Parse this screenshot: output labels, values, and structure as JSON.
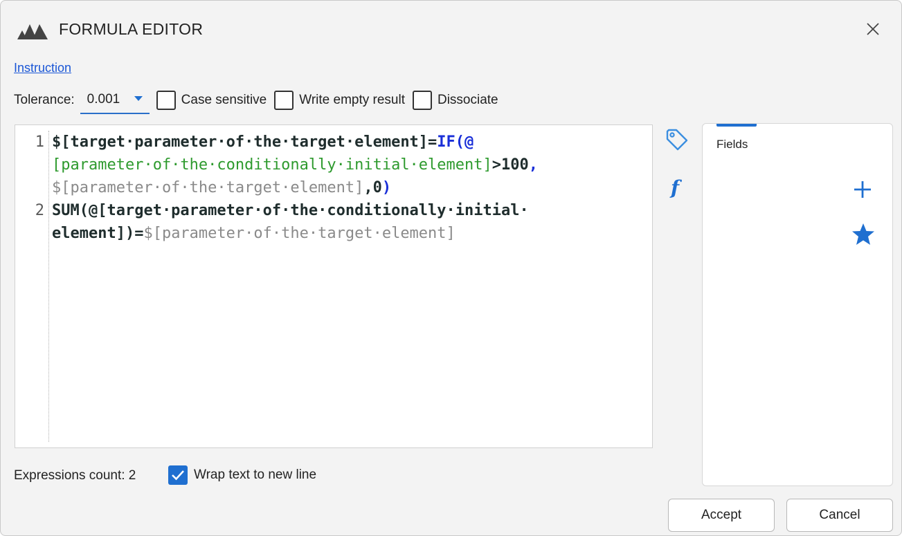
{
  "window": {
    "title": "FORMULA EDITOR",
    "logo_icon": "app-logo-icon",
    "close_icon": "close-icon"
  },
  "instruction_link": "Instruction",
  "options": {
    "tolerance_label": "Tolerance:",
    "tolerance_value": "0.001",
    "case_sensitive_label": "Case sensitive",
    "case_sensitive_checked": false,
    "write_empty_label": "Write empty result",
    "write_empty_checked": false,
    "dissociate_label": "Dissociate",
    "dissociate_checked": false
  },
  "editor": {
    "lines": [
      {
        "number": "1",
        "rows": [
          [
            {
              "text": "$[target·parameter·of·the·target·element]=",
              "style": "t-dark"
            },
            {
              "text": "IF(@",
              "style": "t-kw"
            }
          ],
          [
            {
              "text": "[parameter·of·the·conditionally·initial·element]",
              "style": "t-green"
            },
            {
              "text": ">100",
              "style": "t-dark"
            },
            {
              "text": ",",
              "style": "t-kw"
            }
          ],
          [
            {
              "text": "$[parameter·of·the·target·element]",
              "style": "t-gray"
            },
            {
              "text": ",0",
              "style": "t-dark"
            },
            {
              "text": ")",
              "style": "t-kw"
            }
          ]
        ]
      },
      {
        "number": "2",
        "rows": [
          [
            {
              "text": "SUM(@[target·parameter·of·the·conditionally·initial·",
              "style": "t-dark"
            }
          ],
          [
            {
              "text": "element])=",
              "style": "t-dark"
            },
            {
              "text": "$[parameter·of·the·target·element]",
              "style": "t-gray"
            }
          ]
        ]
      }
    ]
  },
  "side_icons": {
    "tag_icon": "tag-icon",
    "function_icon": "function-icon"
  },
  "fields_panel": {
    "tab_label": "Fields",
    "plus_icon": "plus-icon",
    "star_icon": "star-icon"
  },
  "footer": {
    "expressions_count": "Expressions count: 2",
    "wrap_label": "Wrap text to new line",
    "wrap_checked": true,
    "accept_label": "Accept",
    "cancel_label": "Cancel"
  },
  "colors": {
    "accent": "#1f6fd0",
    "keyword": "#1a2fd8",
    "field_green": "#2e9a2e",
    "field_gray": "#8a8a8a",
    "link": "#1a56d6"
  }
}
